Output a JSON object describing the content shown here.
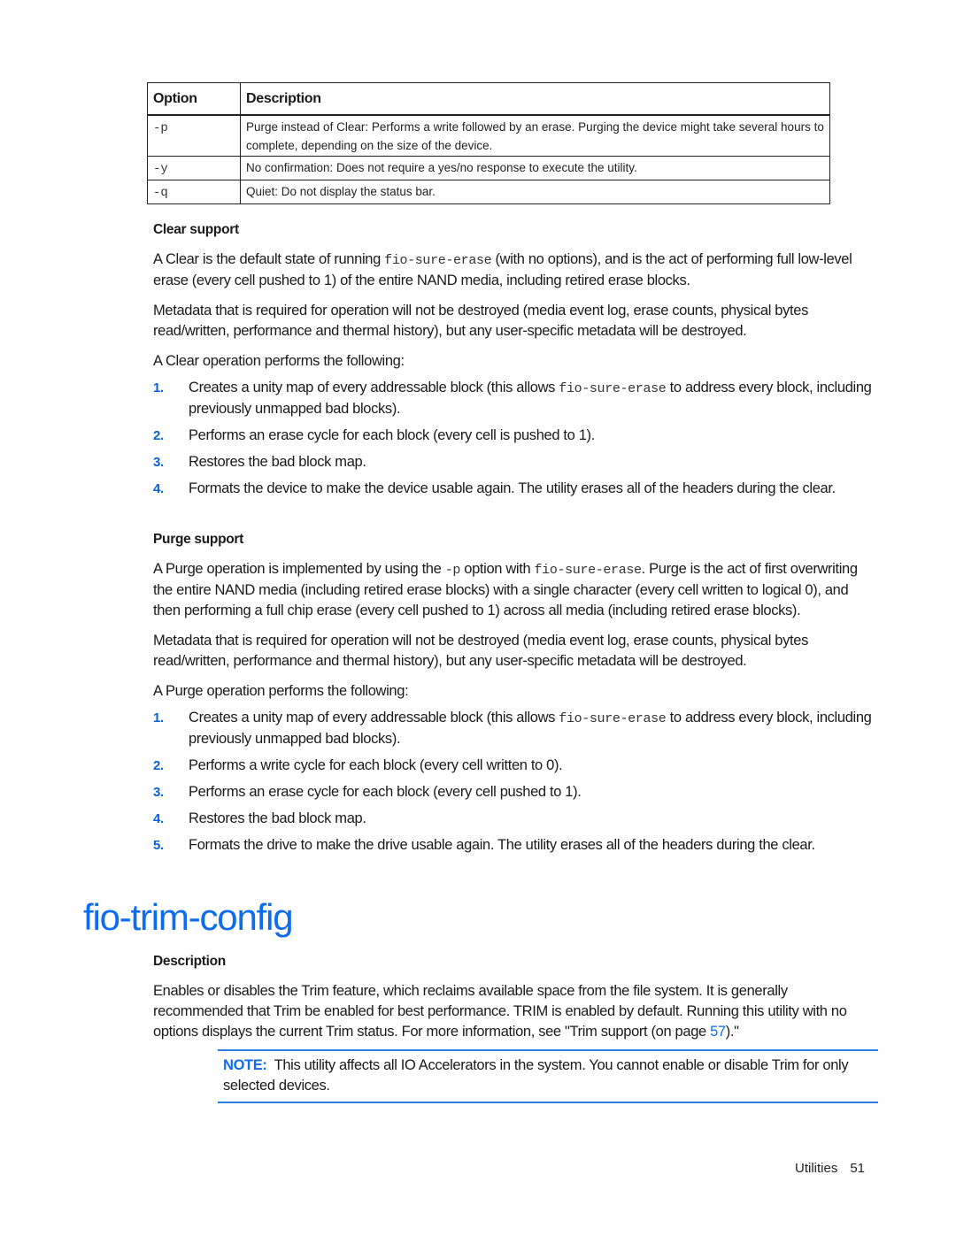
{
  "options_table": {
    "headers": [
      "Option",
      "Description"
    ],
    "rows": [
      {
        "option": "-p",
        "description": "Purge instead of Clear: Performs a write followed by an erase. Purging the device might take several hours to complete, depending on the size of the device."
      },
      {
        "option": "-y",
        "description": "No confirmation: Does not require a yes/no response to execute the utility."
      },
      {
        "option": "-q",
        "description": "Quiet: Do not display the status bar."
      }
    ]
  },
  "clear_support": {
    "heading": "Clear support",
    "para1_a": "A Clear is the default state of running ",
    "para1_code": "fio-sure-erase",
    "para1_b": " (with no options), and is the act of performing full low-level erase (every cell pushed to 1) of the entire NAND media, including retired erase blocks.",
    "para2": "Metadata that is required for operation will not be destroyed (media event log, erase counts, physical bytes read/written, performance and thermal history), but any user-specific metadata will be destroyed.",
    "intro": "A Clear operation performs the following:",
    "steps": [
      {
        "num": "1.",
        "text_a": "Creates a unity map of every addressable block (this allows ",
        "code": "fio-sure-erase",
        "text_b": " to address every block, including previously unmapped bad blocks)."
      },
      {
        "num": "2.",
        "text": "Performs an erase cycle for each block (every cell is pushed to 1)."
      },
      {
        "num": "3.",
        "text": "Restores the bad block map."
      },
      {
        "num": "4.",
        "text": "Formats the device to make the device usable again. The utility erases all of the headers during the clear."
      }
    ]
  },
  "purge_support": {
    "heading": "Purge support",
    "para1_a": "A Purge operation is implemented by using the ",
    "para1_code1": "-p",
    "para1_b": " option with ",
    "para1_code2": "fio-sure-erase",
    "para1_c": ". Purge is the act of first overwriting the entire NAND media (including retired erase blocks) with a single character (every cell written to logical 0), and then performing a full chip erase (every cell pushed to 1) across all media (including retired erase blocks).",
    "para2": "Metadata that is required for operation will not be destroyed (media event log, erase counts, physical bytes read/written, performance and thermal history), but any user-specific metadata will be destroyed.",
    "intro": "A Purge operation performs the following:",
    "steps": [
      {
        "num": "1.",
        "text_a": "Creates a unity map of every addressable block (this allows ",
        "code": "fio-sure-erase",
        "text_b": " to address every block, including previously unmapped bad blocks)."
      },
      {
        "num": "2.",
        "text": "Performs a write cycle for each block (every cell written to 0)."
      },
      {
        "num": "3.",
        "text": "Performs an erase cycle for each block (every cell pushed to 1)."
      },
      {
        "num": "4.",
        "text": "Restores the bad block map."
      },
      {
        "num": "5.",
        "text": "Formats the drive to make the drive usable again. The utility erases all of the headers during the clear."
      }
    ]
  },
  "trim_config": {
    "title": "fio-trim-config",
    "desc_heading": "Description",
    "desc_a": "Enables or disables the Trim feature, which reclaims available space from the file system. It is generally recommended that Trim be enabled for best performance. TRIM is enabled by default. Running this utility with no options displays the current Trim status. For more information, see \"Trim support (on page ",
    "desc_link": "57",
    "desc_b": ").\"",
    "note_label": "NOTE:",
    "note_text": "This utility affects all IO Accelerators in the system. You cannot enable or disable Trim for only selected devices."
  },
  "footer": {
    "section": "Utilities",
    "page": "51"
  },
  "colors": {
    "accent": "#0e6cf0",
    "list_number": "#0a62d6"
  }
}
